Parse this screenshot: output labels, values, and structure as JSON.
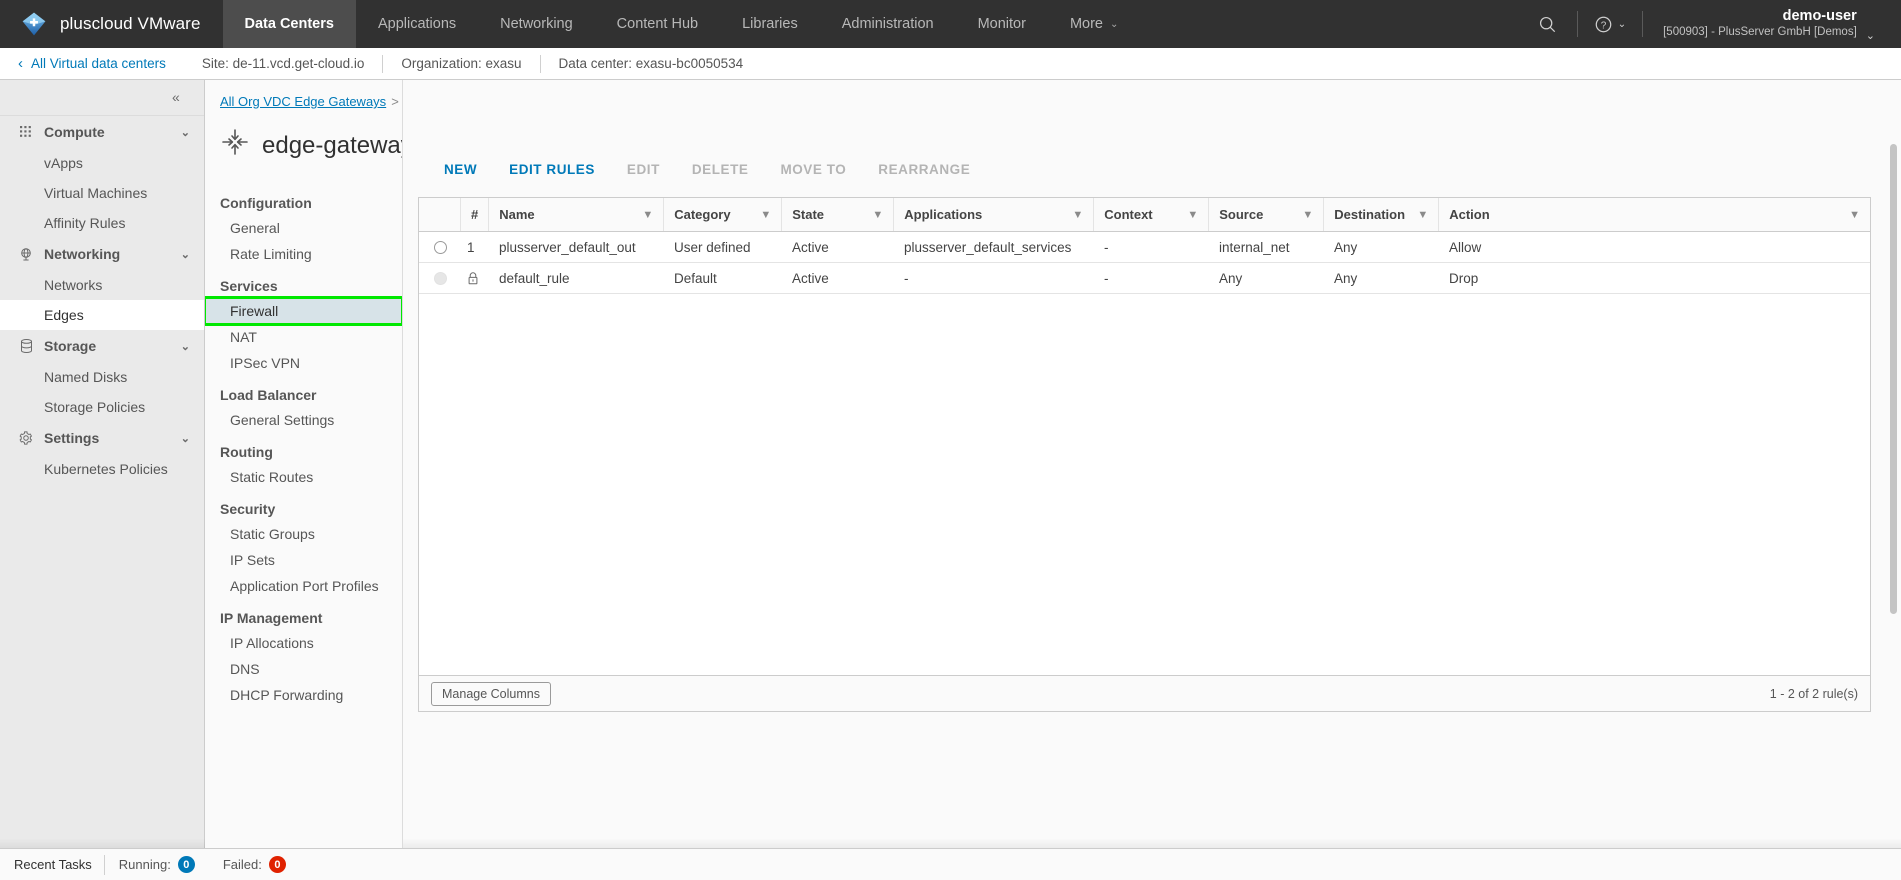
{
  "header": {
    "brand": "pluscloud VMware",
    "brand_logo_icon": "cloud-plus-logo",
    "nav": [
      {
        "label": "Data Centers",
        "active": true,
        "caret": false
      },
      {
        "label": "Applications",
        "active": false,
        "caret": false
      },
      {
        "label": "Networking",
        "active": false,
        "caret": false
      },
      {
        "label": "Content Hub",
        "active": false,
        "caret": false
      },
      {
        "label": "Libraries",
        "active": false,
        "caret": false
      },
      {
        "label": "Administration",
        "active": false,
        "caret": false
      },
      {
        "label": "Monitor",
        "active": false,
        "caret": false
      },
      {
        "label": "More",
        "active": false,
        "caret": true
      }
    ],
    "more_caret": "⌄",
    "search_icon": "search-icon",
    "help_icon": "help-circle-icon",
    "help_caret": "⌄",
    "user_name": "demo-user",
    "user_org": "[500903] - PlusServer GmbH [Demos]",
    "user_caret": "⌄"
  },
  "context_bar": {
    "back_chevron": "‹",
    "back_label": "All Virtual data centers",
    "site": "Site: de-11.vcd.get-cloud.io",
    "organization": "Organization: exasu",
    "data_center": "Data center: exasu-bc0050534"
  },
  "sidebar": {
    "collapse_icon": "«",
    "groups": [
      {
        "label": "Compute",
        "icon": "grid-dots-icon",
        "caret": "⌄",
        "items": [
          {
            "label": "vApps",
            "selected": false
          },
          {
            "label": "Virtual Machines",
            "selected": false
          },
          {
            "label": "Affinity Rules",
            "selected": false
          }
        ]
      },
      {
        "label": "Networking",
        "icon": "network-globe-icon",
        "caret": "⌄",
        "items": [
          {
            "label": "Networks",
            "selected": false
          },
          {
            "label": "Edges",
            "selected": true
          }
        ]
      },
      {
        "label": "Storage",
        "icon": "database-icon",
        "caret": "⌄",
        "items": [
          {
            "label": "Named Disks",
            "selected": false
          },
          {
            "label": "Storage Policies",
            "selected": false
          }
        ]
      },
      {
        "label": "Settings",
        "icon": "gear-icon",
        "caret": "⌄",
        "items": [
          {
            "label": "Kubernetes Policies",
            "selected": false
          }
        ]
      }
    ]
  },
  "gateway_panel": {
    "breadcrumb_link": "All Org VDC Edge Gateways",
    "breadcrumb_separator": ">",
    "breadcrumb_current": "edge-gateway",
    "title": "edge-gateway",
    "title_icon": "edge-gateway-arrows-icon",
    "sections": [
      {
        "heading": "Configuration",
        "links": [
          {
            "label": "General",
            "selected": false,
            "annotated": false
          },
          {
            "label": "Rate Limiting",
            "selected": false,
            "annotated": false
          }
        ]
      },
      {
        "heading": "Services",
        "links": [
          {
            "label": "Firewall",
            "selected": true,
            "annotated": true
          },
          {
            "label": "NAT",
            "selected": false,
            "annotated": false
          },
          {
            "label": "IPSec VPN",
            "selected": false,
            "annotated": false
          }
        ]
      },
      {
        "heading": "Load Balancer",
        "links": [
          {
            "label": "General Settings",
            "selected": false,
            "annotated": false
          }
        ]
      },
      {
        "heading": "Routing",
        "links": [
          {
            "label": "Static Routes",
            "selected": false,
            "annotated": false
          }
        ]
      },
      {
        "heading": "Security",
        "links": [
          {
            "label": "Static Groups",
            "selected": false,
            "annotated": false
          },
          {
            "label": "IP Sets",
            "selected": false,
            "annotated": false
          },
          {
            "label": "Application Port Profiles",
            "selected": false,
            "annotated": false
          }
        ]
      },
      {
        "heading": "IP Management",
        "links": [
          {
            "label": "IP Allocations",
            "selected": false,
            "annotated": false
          },
          {
            "label": "DNS",
            "selected": false,
            "annotated": false
          },
          {
            "label": "DHCP Forwarding",
            "selected": false,
            "annotated": false
          }
        ]
      }
    ]
  },
  "toolbar": {
    "actions": [
      {
        "label": "NEW",
        "enabled": true
      },
      {
        "label": "EDIT RULES",
        "enabled": true
      },
      {
        "label": "EDIT",
        "enabled": false
      },
      {
        "label": "DELETE",
        "enabled": false
      },
      {
        "label": "MOVE TO",
        "enabled": false
      },
      {
        "label": "REARRANGE",
        "enabled": false
      }
    ]
  },
  "firewall_grid": {
    "columns": [
      {
        "key": "sel",
        "label": "",
        "filter": false
      },
      {
        "key": "num",
        "label": "#",
        "filter": false
      },
      {
        "key": "name",
        "label": "Name",
        "filter": true
      },
      {
        "key": "cat",
        "label": "Category",
        "filter": true
      },
      {
        "key": "state",
        "label": "State",
        "filter": true
      },
      {
        "key": "apps",
        "label": "Applications",
        "filter": true
      },
      {
        "key": "ctx",
        "label": "Context",
        "filter": true
      },
      {
        "key": "src",
        "label": "Source",
        "filter": true
      },
      {
        "key": "dst",
        "label": "Destination",
        "filter": true
      },
      {
        "key": "act",
        "label": "Action",
        "filter": true
      }
    ],
    "filter_icon": "filter-funnel-icon",
    "rows": [
      {
        "selectable": true,
        "locked": false,
        "num": "1",
        "name": "plusserver_default_out",
        "category": "User defined",
        "state": "Active",
        "applications": "plusserver_default_services",
        "context": "-",
        "source": "internal_net",
        "destination": "Any",
        "action": "Allow"
      },
      {
        "selectable": false,
        "locked": true,
        "lock_icon": "lock-icon",
        "num": "",
        "name": "default_rule",
        "category": "Default",
        "state": "Active",
        "applications": "-",
        "context": "-",
        "source": "Any",
        "destination": "Any",
        "action": "Drop"
      }
    ],
    "manage_columns_label": "Manage Columns",
    "count_label": "1 - 2 of 2 rule(s)"
  },
  "taskbar": {
    "title": "Recent Tasks",
    "running_label": "Running:",
    "running_count": "0",
    "failed_label": "Failed:",
    "failed_count": "0"
  },
  "colors": {
    "topbar_bg": "#313131",
    "topbar_active": "#4d4d4d",
    "link_blue": "#0079b8",
    "annotation_green": "#00e800",
    "selected_nav_bg": "#d7e3e8",
    "failed_red": "#e02200"
  }
}
